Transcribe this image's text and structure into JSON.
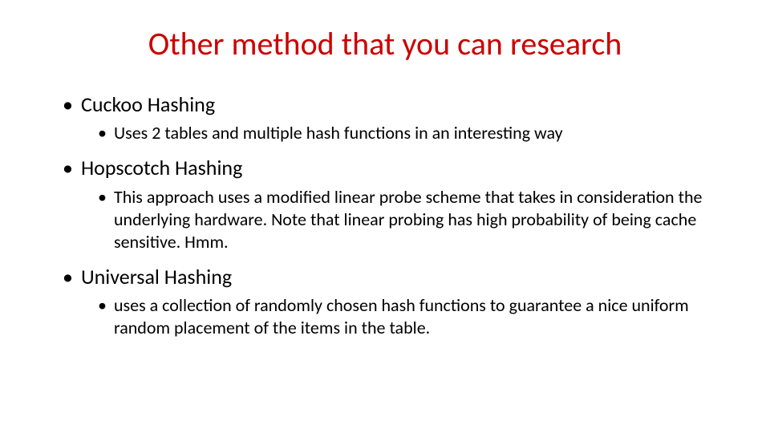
{
  "title": "Other method that you can research",
  "items": [
    {
      "label": "Cuckoo Hashing",
      "sub": "Uses 2 tables and multiple hash functions in an interesting way"
    },
    {
      "label": "Hopscotch Hashing",
      "sub": "This approach uses a modified linear probe scheme that takes in consideration the underlying hardware.  Note that linear probing has high probability of being cache sensitive.   Hmm."
    },
    {
      "label": "Universal Hashing",
      "sub": "uses a collection of randomly chosen hash functions to guarantee a nice uniform random placement of the items in the table."
    }
  ]
}
